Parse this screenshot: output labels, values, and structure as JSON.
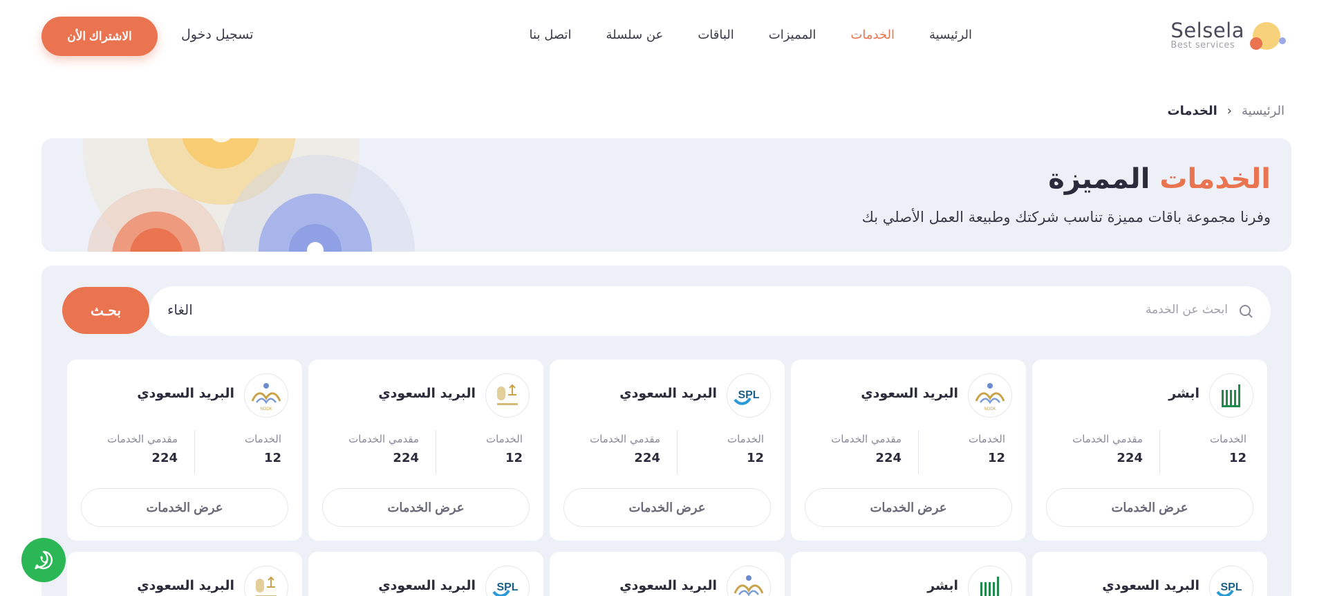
{
  "header": {
    "brand": "Selsela",
    "tagline": "Best services",
    "nav": [
      {
        "label": "الرئيسية",
        "active": false
      },
      {
        "label": "الخدمات",
        "active": true
      },
      {
        "label": "المميزات",
        "active": false
      },
      {
        "label": "الباقات",
        "active": false
      },
      {
        "label": "عن سلسلة",
        "active": false
      },
      {
        "label": "اتصل بنا",
        "active": false
      }
    ],
    "login_label": "تسجيل دخول",
    "subscribe_label": "الاشتراك الأن"
  },
  "breadcrumb": {
    "home": "الرئيسية",
    "separator": "›",
    "current": "الخدمات"
  },
  "hero": {
    "title_accent": "الخدمات",
    "title_rest": "المميزة",
    "subtitle": "وفرنا مجموعة باقات مميزة تناسب شركتك وطبيعة العمل الأصلي بك"
  },
  "search": {
    "placeholder": "ابحث عن الخدمة",
    "clear_label": "الغاء",
    "button_label": "بحـث"
  },
  "cards_row1": [
    {
      "title": "ابشر",
      "logo": "absher-logo",
      "services_label": "الخدمات",
      "services": "12",
      "providers_label": "مقدمي الخدمات",
      "providers": "224",
      "button": "عرض الخدمات"
    },
    {
      "title": "البريد السعودي",
      "logo": "nodk-logo",
      "services_label": "الخدمات",
      "services": "12",
      "providers_label": "مقدمي الخدمات",
      "providers": "224",
      "button": "عرض الخدمات"
    },
    {
      "title": "البريد السعودي",
      "logo": "sbl-logo",
      "services_label": "الخدمات",
      "services": "12",
      "providers_label": "مقدمي الخدمات",
      "providers": "224",
      "button": "عرض الخدمات"
    },
    {
      "title": "البريد السعودي",
      "logo": "civil-affairs-logo",
      "services_label": "الخدمات",
      "services": "12",
      "providers_label": "مقدمي الخدمات",
      "providers": "224",
      "button": "عرض الخدمات"
    },
    {
      "title": "البريد السعودي",
      "logo": "nodk-logo",
      "services_label": "الخدمات",
      "services": "12",
      "providers_label": "مقدمي الخدمات",
      "providers": "224",
      "button": "عرض الخدمات"
    }
  ],
  "cards_row2": [
    {
      "title": "البريد السعودي",
      "logo": "sbl-logo"
    },
    {
      "title": "ابشر",
      "logo": "absher-logo"
    },
    {
      "title": "البريد السعودي",
      "logo": "nodk-logo"
    },
    {
      "title": "البريد السعودي",
      "logo": "sbl-logo"
    },
    {
      "title": "البريد السعودي",
      "logo": "civil-affairs-logo"
    }
  ],
  "colors": {
    "accent": "#ea7350",
    "panel": "#edf0f7",
    "whatsapp": "#2bb755"
  },
  "icons": {
    "search": "search-icon",
    "whatsapp": "whatsapp-icon"
  }
}
